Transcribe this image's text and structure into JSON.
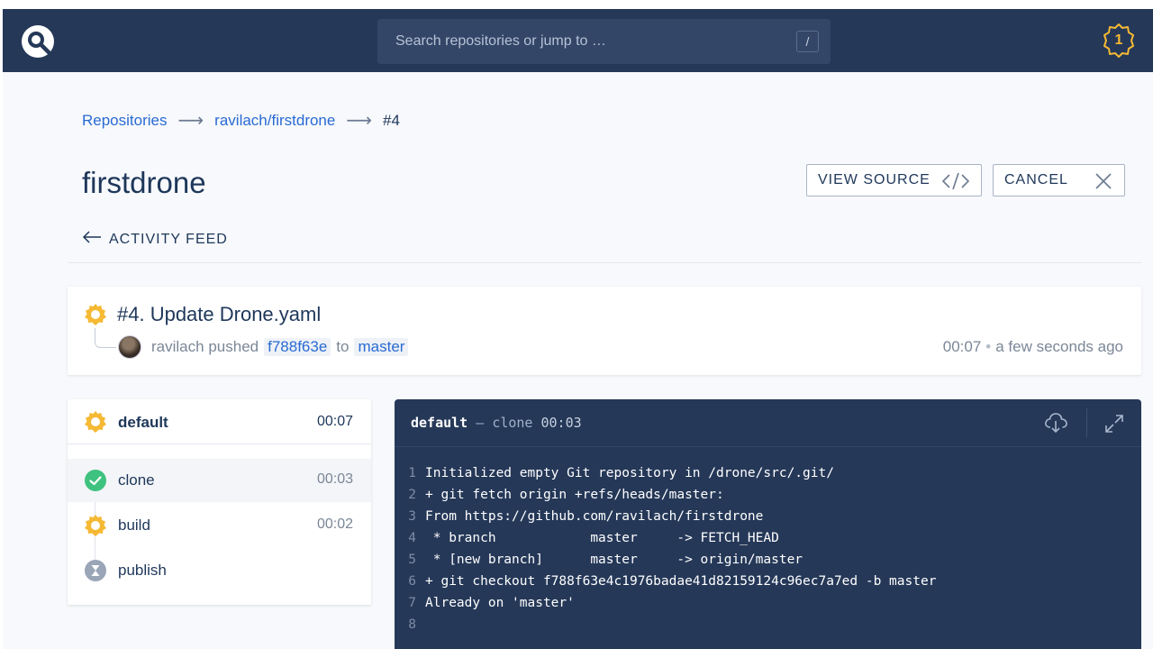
{
  "header": {
    "search_placeholder": "Search repositories or jump to …",
    "search_shortcut": "/",
    "notification_count": "1"
  },
  "breadcrumb": {
    "items": [
      "Repositories",
      "ravilach/firstdrone",
      "#4"
    ]
  },
  "page": {
    "title": "firstdrone",
    "view_source_label": "VIEW SOURCE",
    "cancel_label": "CANCEL",
    "activity_feed_label": "ACTIVITY FEED"
  },
  "build": {
    "title": "#4. Update Drone.yaml",
    "author": "ravilach",
    "action": "pushed",
    "commit": "f788f63e",
    "to_word": "to",
    "branch": "master",
    "duration": "00:07",
    "when": "a few seconds ago"
  },
  "stage": {
    "name": "default",
    "duration": "00:07",
    "steps": [
      {
        "name": "clone",
        "duration": "00:03",
        "status": "success"
      },
      {
        "name": "build",
        "duration": "00:02",
        "status": "running"
      },
      {
        "name": "publish",
        "duration": "",
        "status": "pending"
      }
    ]
  },
  "log": {
    "stage": "default",
    "step": "clone",
    "duration": "00:03",
    "lines": [
      "Initialized empty Git repository in /drone/src/.git/",
      "+ git fetch origin +refs/heads/master:",
      "From https://github.com/ravilach/firstdrone",
      " * branch            master     -> FETCH_HEAD",
      " * [new branch]      master     -> origin/master",
      "+ git checkout f788f63e4c1976badae41d82159124c96ec7a7ed -b master",
      "Already on 'master'",
      ""
    ]
  },
  "colors": {
    "header_bg": "#253858",
    "accent_blue": "#2a6ad3",
    "running_yellow": "#f5b934",
    "success_green": "#3fc27f",
    "pending_gray": "#9aa6b7"
  }
}
